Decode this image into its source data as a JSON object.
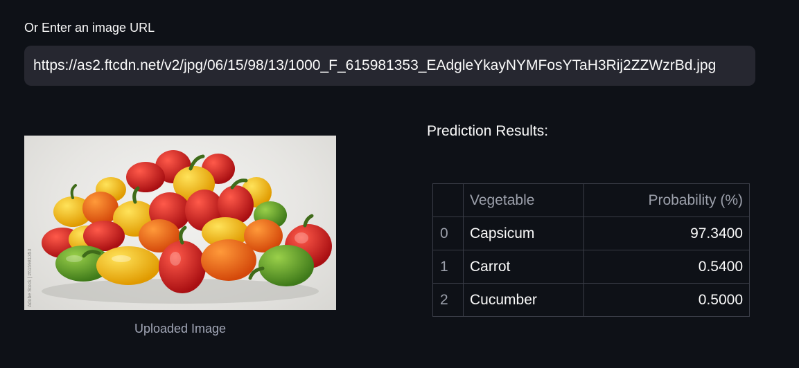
{
  "url_field": {
    "label": "Or Enter an image URL",
    "value": "https://as2.ftcdn.net/v2/jpg/06/15/98/13/1000_F_615981353_EAdgleYkayNYMFosYTaH3Rij2ZZWzrBd.jpg"
  },
  "image": {
    "caption": "Uploaded Image",
    "watermark": "Adobe Stock | #615981353"
  },
  "prediction": {
    "title": "Prediction Results:",
    "columns": [
      "",
      "Vegetable",
      "Probability (%)"
    ],
    "rows": [
      {
        "index": "0",
        "vegetable": "Capsicum",
        "probability": "97.3400"
      },
      {
        "index": "1",
        "vegetable": "Carrot",
        "probability": "0.5400"
      },
      {
        "index": "2",
        "vegetable": "Cucumber",
        "probability": "0.5000"
      }
    ]
  },
  "colors": {
    "background": "#0e1117",
    "input_bg": "#262730",
    "text": "#fafafa",
    "muted": "#a3a8b8",
    "table_border": "#3a3d47"
  }
}
